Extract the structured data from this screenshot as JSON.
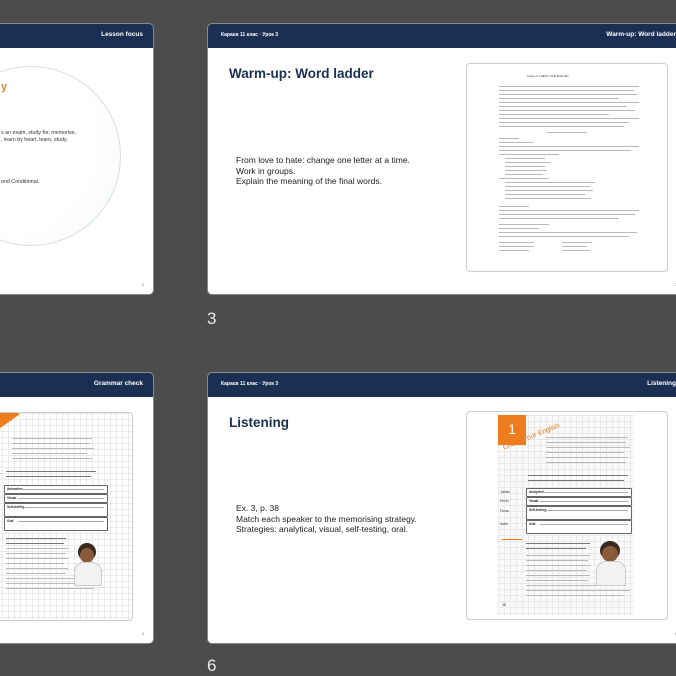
{
  "slides": [
    {
      "header_left": "",
      "header_right": "Lesson focus",
      "title_fragment": "y",
      "text_lines": [
        "s an exam, study for, memorise,",
        ", learn by heart, learn, study,"
      ],
      "footer_line": "ond Conditional."
    },
    {
      "header_left": "Караєв 11 клас · Урок 3",
      "header_right": "Warm-up: Word ladder",
      "title": "Warm-up: Word ladder",
      "body_lines": [
        "From love to hate: change one letter at a time.",
        "Work in groups.",
        "Explain the meaning of the final words."
      ],
      "thumb_doc_title": "Lesson 3: CHECK YOUR ENGLISH"
    },
    {
      "header_left": "",
      "header_right": "Grammar check",
      "book_labels": [
        "Animation",
        "Visual",
        "Self-testing",
        "Oral"
      ]
    },
    {
      "header_left": "Караєв 11 клас · Урок 3",
      "header_right": "Listening",
      "title": "Listening",
      "body_lines": [
        "Ex. 3, p. 38",
        "Match each speaker to the memorising strategy.",
        "Strategies: analytical, visual, self-testing, oral."
      ],
      "book_unit": "1",
      "book_title": "Check Your English",
      "book_labels": [
        "Analytical",
        "Visual",
        "Self-testing",
        "Oral"
      ],
      "book_side_names": [
        "James",
        "Kevin",
        "Fiona",
        "Katie"
      ]
    }
  ],
  "page_numbers": {
    "slide_3": "3",
    "slide_6": "6"
  },
  "colors": {
    "background": "#4c4c4c",
    "header": "#1b2f52",
    "accent_orange": "#ee7d1f"
  }
}
